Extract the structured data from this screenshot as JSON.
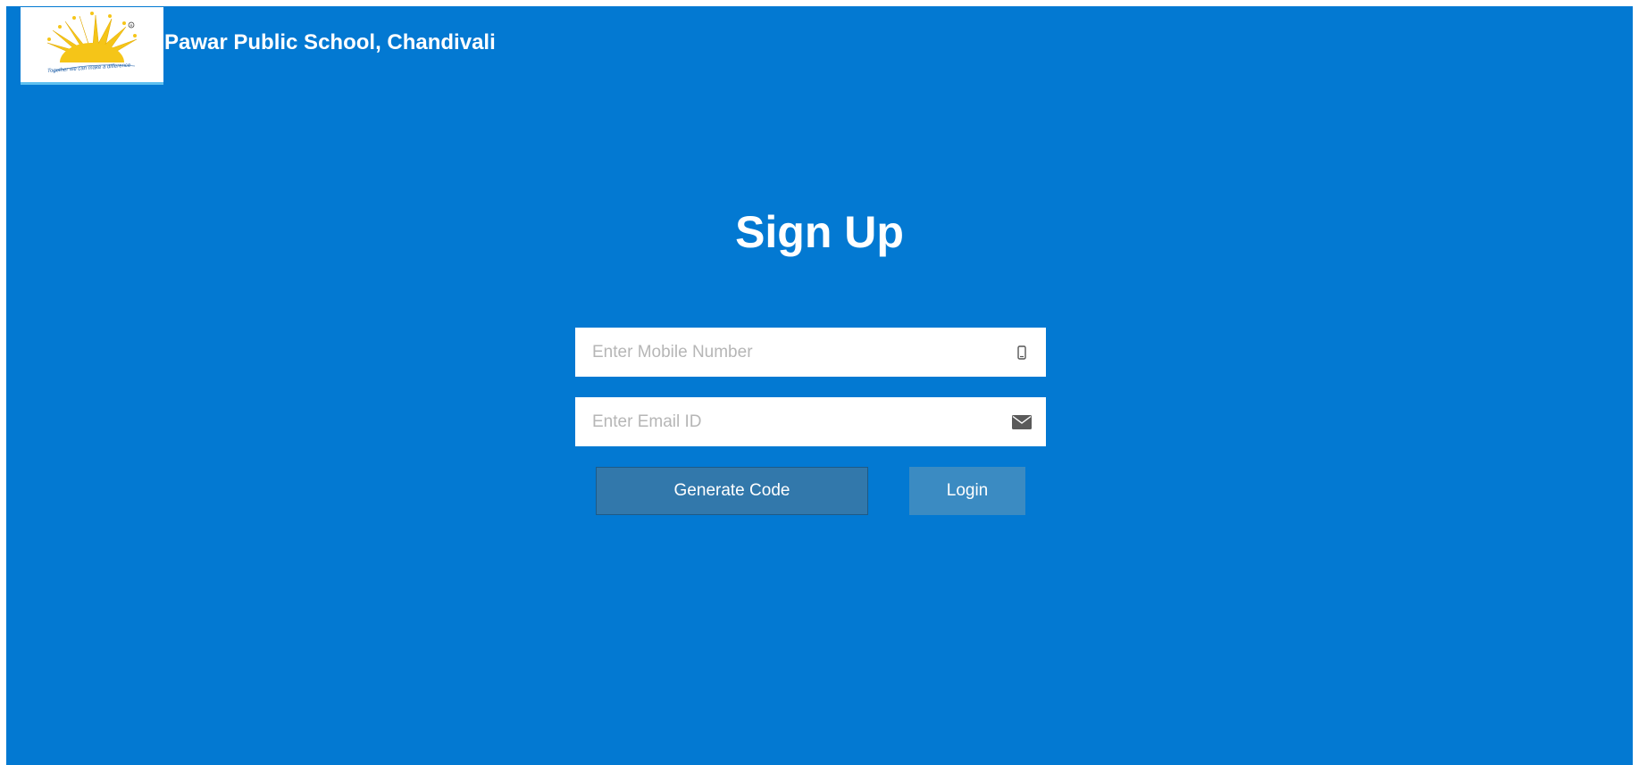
{
  "header": {
    "logo_tagline": "Together we can make a difference",
    "school_name": "Pawar Public School, Chandivali"
  },
  "main": {
    "title": "Sign Up",
    "mobile": {
      "placeholder": "Enter Mobile Number",
      "value": "",
      "icon": "mobile-phone-icon"
    },
    "email": {
      "placeholder": "Enter Email ID",
      "value": "",
      "icon": "envelope-icon"
    },
    "generate_label": "Generate Code",
    "login_label": "Login"
  },
  "colors": {
    "background": "#0379d2",
    "generate_button": "#3278ab",
    "login_button": "#3b8bc2",
    "logo_sun": "#f5c518"
  }
}
